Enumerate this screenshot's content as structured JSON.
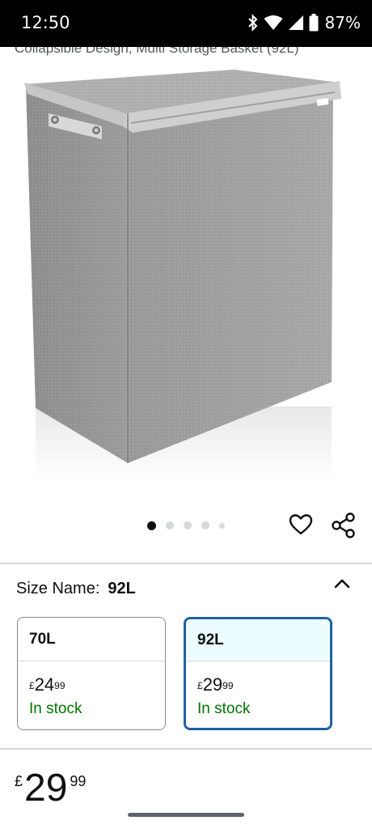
{
  "status_bar": {
    "time": "12:50",
    "battery_percent": "87%",
    "icons": [
      "bluetooth-icon",
      "wifi-icon",
      "cell-signal-icon",
      "battery-icon"
    ]
  },
  "product": {
    "title_fragment": "Collapsible Design, Multi Storage Basket (92L)",
    "image_alt": "grey-fabric-laundry-hamper",
    "image_count": 5,
    "active_image_index": 0
  },
  "actions": {
    "icons": [
      "heart-icon",
      "share-icon"
    ]
  },
  "size_selector": {
    "label": "Size Name:",
    "selected_value": "92L",
    "options": [
      {
        "name": "70L",
        "currency": "£",
        "price_whole": "24",
        "price_fraction": "99",
        "availability": "In stock",
        "selected": false
      },
      {
        "name": "92L",
        "currency": "£",
        "price_whole": "29",
        "price_fraction": "99",
        "availability": "In stock",
        "selected": true
      }
    ]
  },
  "price": {
    "currency": "£",
    "whole": "29",
    "fraction": "99"
  },
  "colors": {
    "in_stock_green": "#007600",
    "selected_border": "#2162a1",
    "selected_bg": "#edfdff"
  }
}
